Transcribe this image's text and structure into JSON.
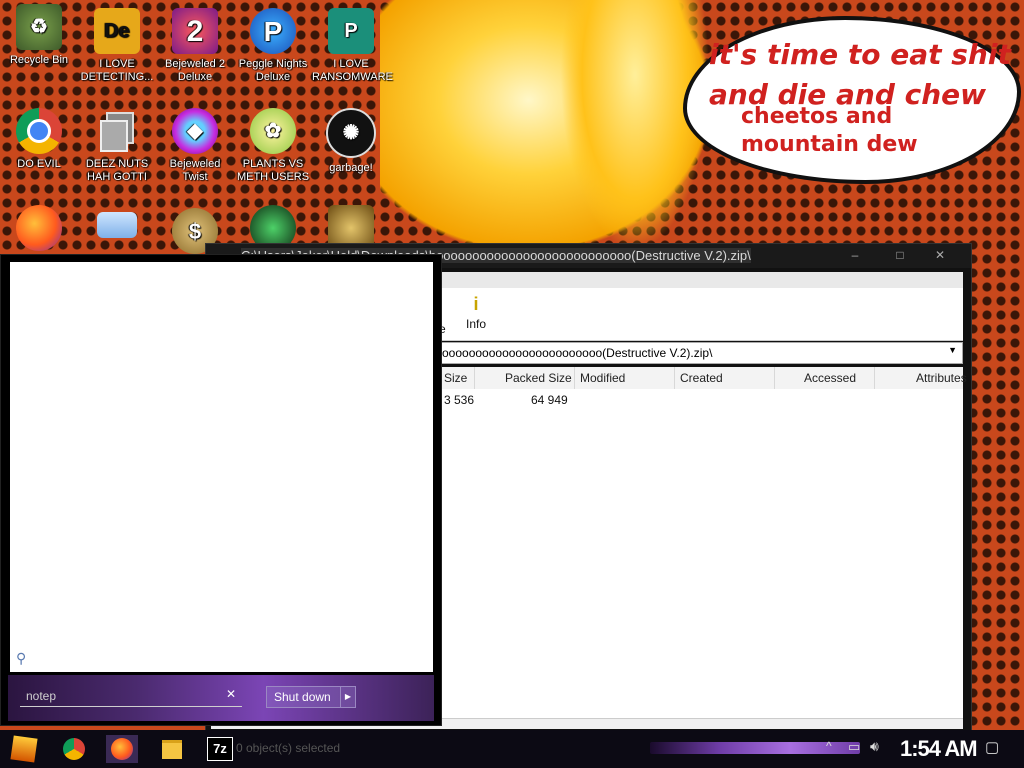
{
  "wallpaper": {
    "speech_line1": "it's time to eat shit",
    "speech_line2": "and die and chew",
    "speech_line3": "cheetos and",
    "speech_line4": "mountain dew"
  },
  "desktop_icons": [
    {
      "label": "Recycle Bin",
      "icon": "recycle-bin-icon"
    },
    {
      "label": "I LOVE DETECTING...",
      "icon": "de-icon",
      "glyph": "De"
    },
    {
      "label": "Bejeweled 2 Deluxe",
      "icon": "bejeweled-2-icon",
      "glyph": "2"
    },
    {
      "label": "Peggle Nights Deluxe",
      "icon": "peggle-icon",
      "glyph": "P"
    },
    {
      "label": "I LOVE RANSOMWARE",
      "icon": "publisher-icon",
      "glyph": "P"
    },
    {
      "label": "DO EVIL",
      "icon": "chrome-icon"
    },
    {
      "label": "DEEZ NUTS HAH GOTTI",
      "icon": "copy-icon"
    },
    {
      "label": "Bejeweled Twist",
      "icon": "bejeweled-twist-icon"
    },
    {
      "label": "PLANTS VS METH USERS",
      "icon": "plants-icon"
    },
    {
      "label": "garbage!",
      "icon": "garbage-icon"
    }
  ],
  "zip_window": {
    "title": "C:\\Users\\Joker\\Hold\\Downloads\\booooooooooooooooooooooooooo(Destructive V.2).zip\\",
    "toolbar_info": "Info",
    "toolbar_partial": "e",
    "address": "oooooooooooooooooooooooo(Destructive V.2).zip\\",
    "columns": [
      "Size",
      "Packed Size",
      "Modified",
      "Created",
      "Accessed",
      "Attributes"
    ],
    "row": {
      "size": "3 536",
      "packed": "64 949"
    },
    "status": "0 object(s) selected"
  },
  "start_menu": {
    "search_value": "notep",
    "shutdown_label": "Shut down"
  },
  "taskbar": {
    "clock": "1:54 AM",
    "sevenzip_label": "7z"
  },
  "colors": {
    "accent_purple": "#7b45b5",
    "speech_red": "#d0211f"
  }
}
